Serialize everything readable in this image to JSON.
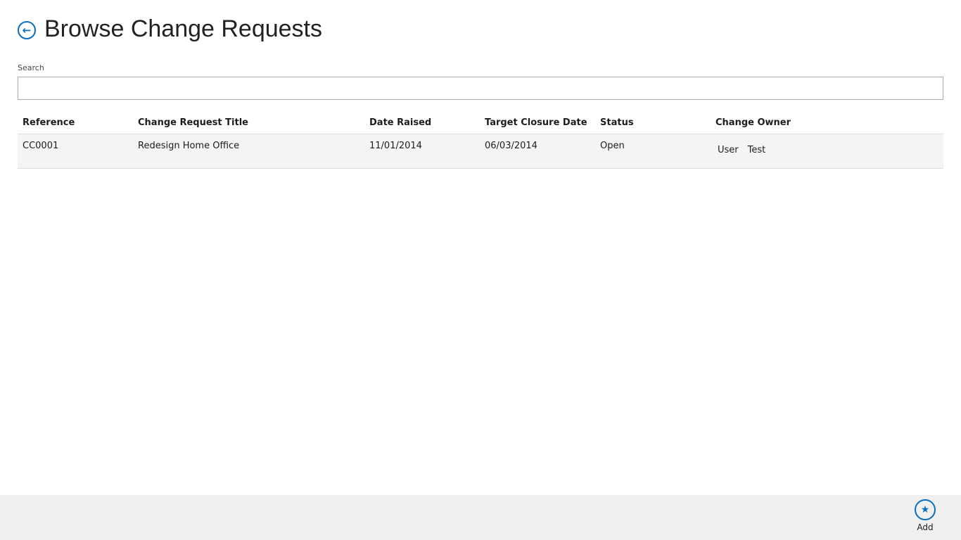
{
  "header": {
    "title": "Browse Change Requests",
    "back_icon": "arrow-left-circle"
  },
  "search": {
    "label": "Search",
    "value": "",
    "placeholder": ""
  },
  "table": {
    "columns": [
      "Reference",
      "Change Request Title",
      "Date Raised",
      "Target Closure Date",
      "Status",
      "Change Owner"
    ],
    "rows": [
      {
        "reference": "CC0001",
        "title": "Redesign Home Office",
        "date_raised": "11/01/2014",
        "target_closure": "06/03/2014",
        "status": "Open",
        "owner_first": "User",
        "owner_last": "Test"
      }
    ]
  },
  "appbar": {
    "add_label": "Add",
    "add_icon": "star-circle"
  },
  "colors": {
    "accent": "#0a6ebd",
    "appbar": "#f0f0f0"
  }
}
